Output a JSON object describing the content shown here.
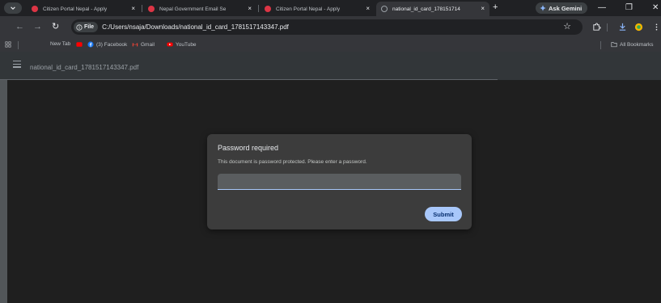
{
  "browser": {
    "tabs": [
      {
        "title": "Citizen Portal Nepal - Apply",
        "active": false
      },
      {
        "title": "Nepal Government Email Se",
        "active": false
      },
      {
        "title": "Citizen Portal Nepal - Apply",
        "active": false
      },
      {
        "title": "national_id_card_178151714",
        "active": true
      }
    ],
    "new_tab_symbol": "+",
    "close_symbol": "×",
    "gemini_label": "Ask Gemini",
    "window_controls": {
      "minimize": "—",
      "maximize": "❐",
      "close": "✕"
    }
  },
  "toolbar": {
    "back": "←",
    "forward": "→",
    "reload": "↻",
    "site_chip": "File",
    "url": "C:/Users/nsaja/Downloads/national_id_card_1781517143347.pdf",
    "star": "☆"
  },
  "bookmarks": {
    "items": [
      "New Tab",
      "",
      "(3) Facebook",
      "Gmail",
      "YouTube"
    ],
    "all_bookmarks": "All Bookmarks"
  },
  "pdf_viewer": {
    "filename": "national_id_card_1781517143347.pdf"
  },
  "dialog": {
    "title": "Password required",
    "message": "This document is password protected. Please enter a password.",
    "input_value": "",
    "submit_label": "Submit"
  },
  "colors": {
    "accent": "#a8c7fa",
    "favicon_red": "#dc3545",
    "facebook_blue": "#1877f2",
    "youtube_red": "#ff0000"
  }
}
